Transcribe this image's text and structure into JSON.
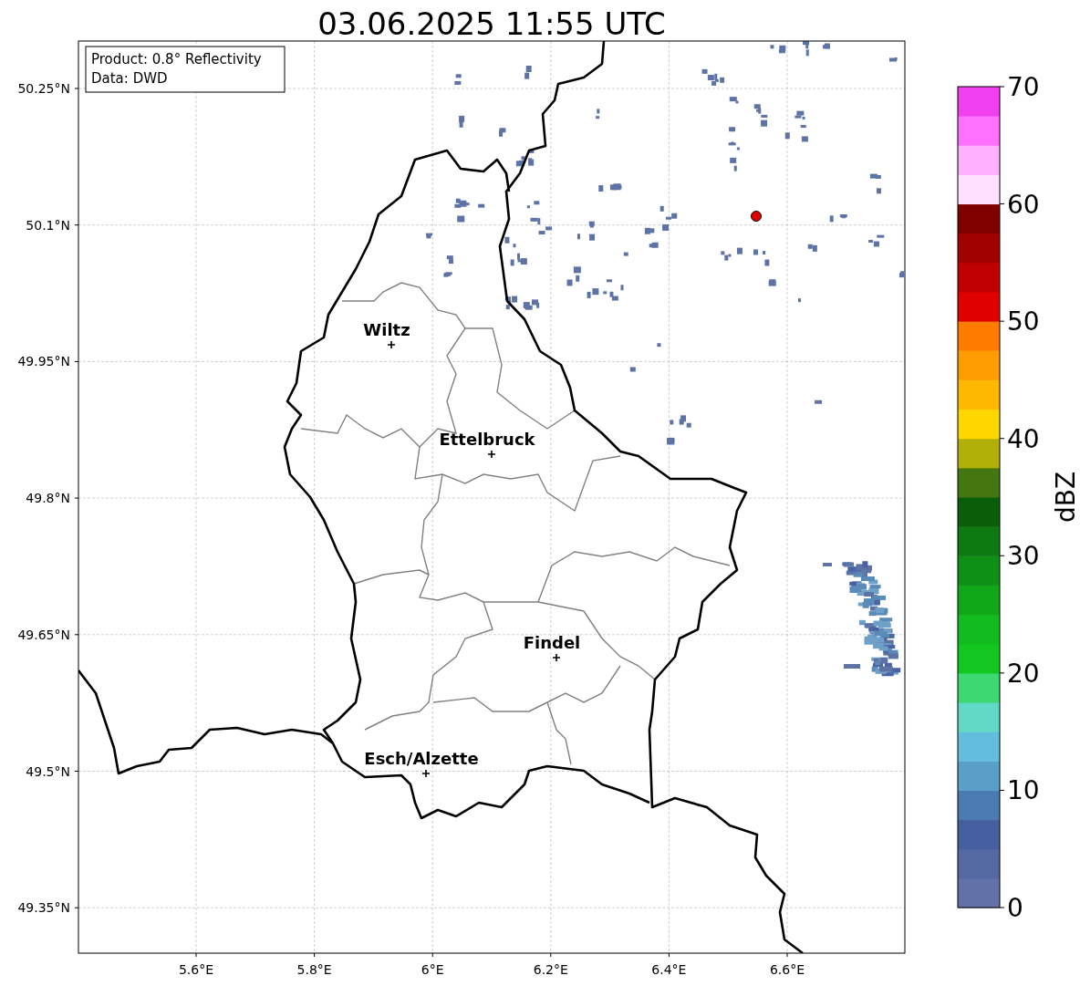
{
  "title": "03.06.2025 11:55 UTC",
  "info_box": {
    "lines": [
      "Product: 0.8° Reflectivity",
      "Data: DWD"
    ]
  },
  "y_ticks": [
    "50.25°N",
    "50.1°N",
    "49.95°N",
    "49.8°N",
    "49.65°N",
    "49.5°N",
    "49.35°N"
  ],
  "x_ticks": [
    "5.6°E",
    "5.8°E",
    "6°E",
    "6.2°E",
    "6.4°E",
    "6.6°E"
  ],
  "cities": [
    {
      "name": "Wiltz"
    },
    {
      "name": "Ettelbruck"
    },
    {
      "name": "Findel"
    },
    {
      "name": "Esch/Alzette"
    }
  ],
  "colorbar": {
    "label": "dBZ",
    "ticks": [
      "70",
      "60",
      "50",
      "40",
      "30",
      "20",
      "10",
      "0"
    ],
    "segments": [
      {
        "color": "#6272a8"
      },
      {
        "color": "#5468a2"
      },
      {
        "color": "#465fa0"
      },
      {
        "color": "#4a7ab2"
      },
      {
        "color": "#5a9fc8"
      },
      {
        "color": "#62bedc"
      },
      {
        "color": "#62d8c6"
      },
      {
        "color": "#3ed870"
      },
      {
        "color": "#12c820"
      },
      {
        "color": "#12bb1e"
      },
      {
        "color": "#10a818"
      },
      {
        "color": "#0e9016"
      },
      {
        "color": "#0c7a10"
      },
      {
        "color": "#0a5e0a"
      },
      {
        "color": "#457710"
      },
      {
        "color": "#b0b008"
      },
      {
        "color": "#ffd700"
      },
      {
        "color": "#ffb800"
      },
      {
        "color": "#ff9c00"
      },
      {
        "color": "#ff7c00"
      },
      {
        "color": "#e00000"
      },
      {
        "color": "#c00000"
      },
      {
        "color": "#a00000"
      },
      {
        "color": "#800000"
      },
      {
        "color": "#ffe0ff"
      },
      {
        "color": "#ffb0ff"
      },
      {
        "color": "#ff70ff"
      },
      {
        "color": "#f040f0"
      }
    ]
  }
}
